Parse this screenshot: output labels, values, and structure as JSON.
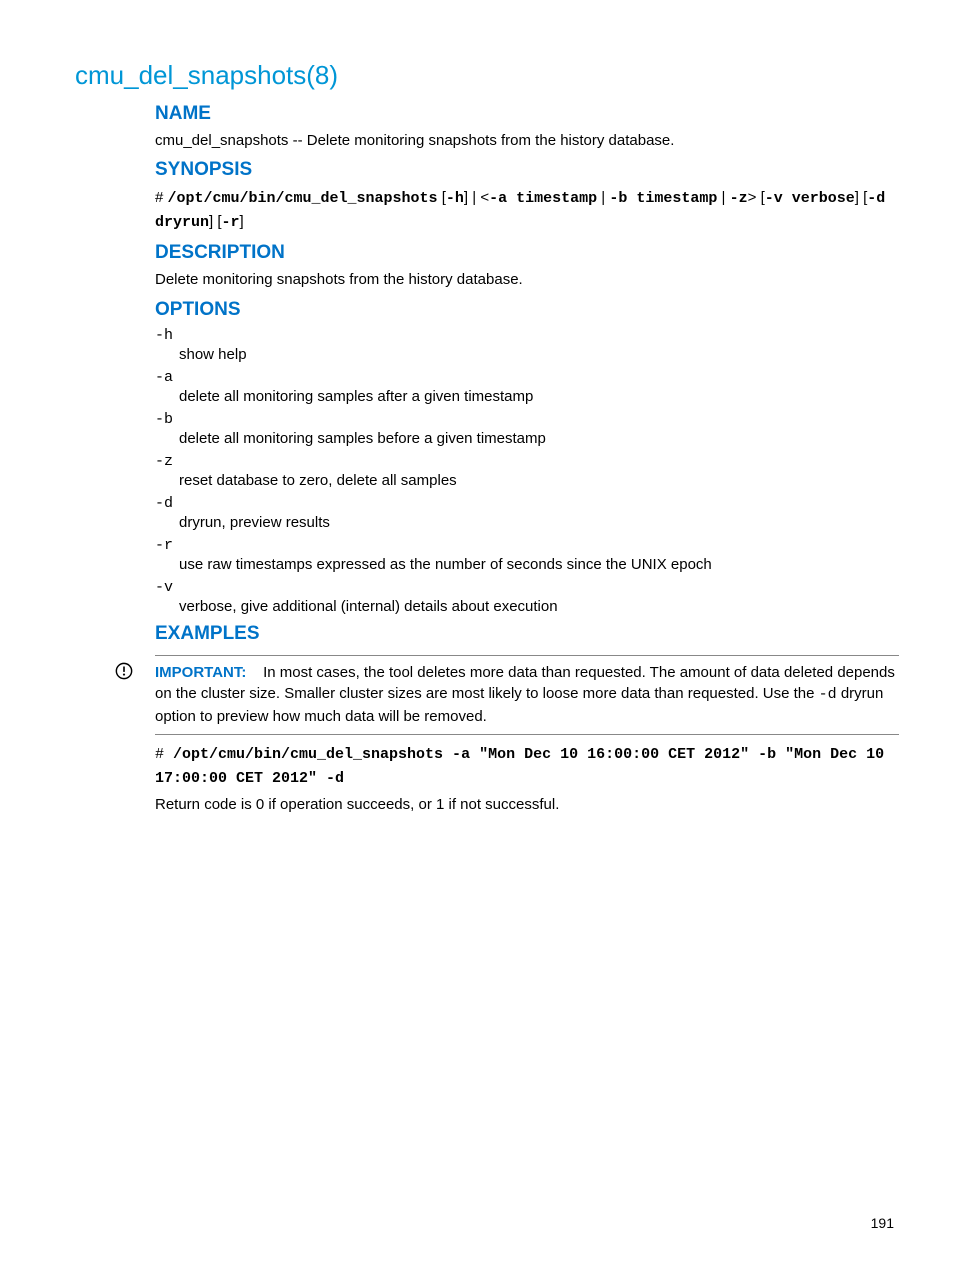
{
  "title": "cmu_del_snapshots(8)",
  "sections": {
    "name": {
      "heading": "NAME",
      "text": "cmu_del_snapshots -- Delete monitoring snapshots from the history database."
    },
    "synopsis": {
      "heading": "SYNOPSIS",
      "prompt": "# ",
      "cmd": "/opt/cmu/bin/cmu_del_snapshots",
      "parts": {
        "p1": " [",
        "p2": "-h",
        "p3": "] | <",
        "p4": "-a timestamp",
        "p5": " | ",
        "p6": "-b timestamp",
        "p7": " | ",
        "p8": "-z",
        "p9": "> [",
        "p10": "-v verbose",
        "p11": "] [",
        "p12": "-d dryrun",
        "p13": "] [",
        "p14": "-r",
        "p15": "]"
      }
    },
    "description": {
      "heading": "DESCRIPTION",
      "text": "Delete monitoring snapshots from the history database."
    },
    "options": {
      "heading": "OPTIONS",
      "items": [
        {
          "flag": "-h",
          "desc": "show help"
        },
        {
          "flag": "-a",
          "desc": "delete all monitoring samples after a given timestamp"
        },
        {
          "flag": "-b",
          "desc": "delete all monitoring samples before a given timestamp"
        },
        {
          "flag": "-z",
          "desc": "reset database to zero, delete all samples"
        },
        {
          "flag": "-d",
          "desc": "dryrun, preview results"
        },
        {
          "flag": "-r",
          "desc": "use raw timestamps expressed as the number of seconds since the UNIX epoch"
        },
        {
          "flag": "-v",
          "desc": "verbose, give additional (internal) details about execution"
        }
      ]
    },
    "examples": {
      "heading": "EXAMPLES",
      "important_label": "IMPORTANT:",
      "important_text_a": "In most cases, the tool deletes more data than requested. The amount of data deleted depends on the cluster size. Smaller cluster sizes are most likely to loose more data than requested. Use the ",
      "important_code": "-d",
      "important_text_b": " dryrun option to preview how much data will be removed.",
      "cmd_prompt": "# ",
      "cmd_text": "/opt/cmu/bin/cmu_del_snapshots -a \"Mon Dec 10 16:00:00 CET 2012\" -b \"Mon Dec 10 17:00:00 CET 2012\" -d",
      "return_text": "Return code is 0 if operation succeeds, or 1 if not successful."
    }
  },
  "page_number": "191"
}
